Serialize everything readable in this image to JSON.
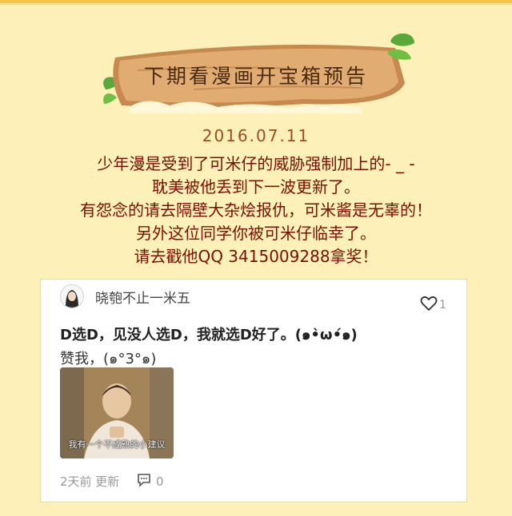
{
  "banner": {
    "title": "下期看漫画开宝箱预告"
  },
  "date": "2016.07.11",
  "message_lines": [
    "少年漫是受到了可米仔的威胁强制加上的- _ -",
    "耽美被他丢到下一波更新了。",
    "有怨念的请去隔壁大杂烩报仇，可米酱是无辜的！",
    "另外这位同学你被可米仔临幸了。",
    "请去戳他QQ 3415009288拿奖！"
  ],
  "comment": {
    "username": "晓匏不止一米五",
    "likes": "1",
    "text_main": "D选D，见没人选D，我就选D好了。(๑•̀ω•́๑)",
    "text_sub": "赞我，(๑°3°๑)",
    "meme_caption": "我有一个不成熟的小建议",
    "time": "2天前 更新",
    "comments": "0"
  },
  "colors": {
    "background": "#fdf0b8",
    "message_text": "#7a0f00",
    "date_text": "#9a4e20",
    "wood": "#d9a56a"
  }
}
